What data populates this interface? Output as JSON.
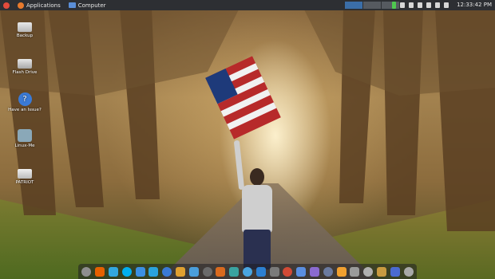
{
  "top_panel": {
    "applications_label": "Applications",
    "computer_label": "Computer",
    "clock": "12:33:42 PM",
    "workspace_count": 3,
    "active_workspace": 1
  },
  "desktop_icons": [
    {
      "label": "Backup",
      "icon": "drive-icon"
    },
    {
      "label": "Flash Drive",
      "icon": "usb-drive-icon"
    },
    {
      "label": "Have an Issue?",
      "icon": "help-icon"
    },
    {
      "label": "Linux-Me",
      "icon": "user-avatar-icon"
    },
    {
      "label": "PATRIOT",
      "icon": "removable-drive-icon"
    }
  ],
  "dock": {
    "icons": [
      "settings-icon",
      "firefox-icon",
      "chrome-icon",
      "skype-icon",
      "chat-icon",
      "telegram-icon",
      "water-icon",
      "music-icon",
      "network-icon",
      "library-icon",
      "firefox-alt-icon",
      "arrow-icon",
      "app-store-icon",
      "email-icon",
      "tweaks-icon",
      "photos-icon",
      "browser-icon",
      "image-viewer-icon",
      "monitor-icon",
      "weather-icon",
      "mobile-icon",
      "file-manager-icon",
      "coin-icon",
      "windows-icon",
      "trash-icon"
    ],
    "colors": [
      "#8e8e8e",
      "#e66000",
      "#33a7df",
      "#00aff0",
      "#3b8fe3",
      "#2aa3dd",
      "#3a7ad6",
      "#e0a030",
      "#4a9edb",
      "#6a6a6a",
      "#d96a1e",
      "#3aa3a0",
      "#4aa5e0",
      "#2c7fd1",
      "#7a7a7a",
      "#d24a35",
      "#5a8ee0",
      "#8a6ad0",
      "#6a7aa0",
      "#f0a030",
      "#9a9a9a",
      "#b0b0b0",
      "#c89a40",
      "#4a6ad0",
      "#a8a8a8"
    ]
  },
  "colors": {
    "panel_bg": "#2d2f33",
    "active_workspace": "#3b6ea8"
  }
}
